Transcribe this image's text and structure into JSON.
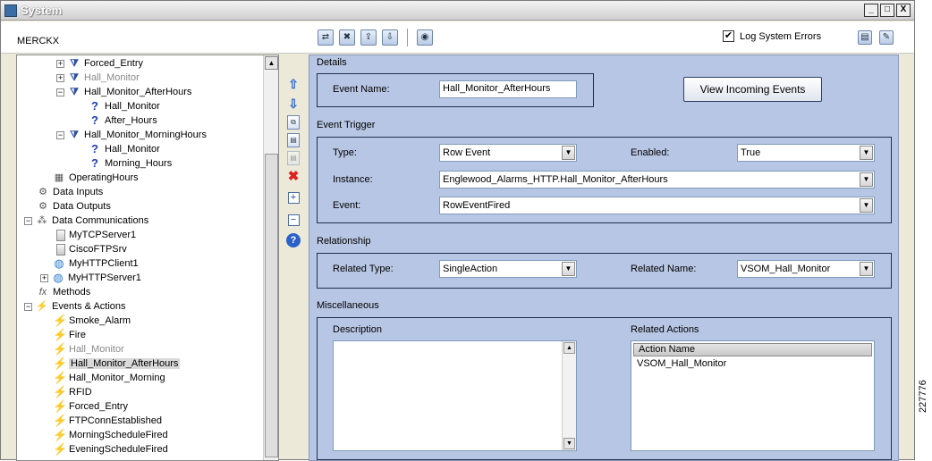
{
  "window": {
    "title": "System",
    "minimize": "_",
    "restore": "□",
    "close": "X"
  },
  "toolbar": {
    "server": "MERCKX",
    "log_errors_label": "Log System Errors",
    "log_errors_checked": "✔"
  },
  "tree": {
    "nodes": [
      {
        "label": "Forced_Entry"
      },
      {
        "label": "Hall_Monitor"
      },
      {
        "label": "Hall_Monitor_AfterHours"
      },
      {
        "label": "Hall_Monitor"
      },
      {
        "label": "After_Hours"
      },
      {
        "label": "Hall_Monitor_MorningHours"
      },
      {
        "label": "Hall_Monitor"
      },
      {
        "label": "Morning_Hours"
      },
      {
        "label": "OperatingHours"
      },
      {
        "label": "Data Inputs"
      },
      {
        "label": "Data Outputs"
      },
      {
        "label": "Data Communications"
      },
      {
        "label": "MyTCPServer1"
      },
      {
        "label": "CiscoFTPSrv"
      },
      {
        "label": "MyHTTPClient1"
      },
      {
        "label": "MyHTTPServer1"
      },
      {
        "label": "Methods"
      },
      {
        "label": "Events & Actions"
      },
      {
        "label": "Smoke_Alarm"
      },
      {
        "label": "Fire"
      },
      {
        "label": "Hall_Monitor"
      },
      {
        "label": "Hall_Monitor_AfterHours"
      },
      {
        "label": "Hall_Monitor_Morning"
      },
      {
        "label": "RFID"
      },
      {
        "label": "Forced_Entry"
      },
      {
        "label": "FTPConnEstablished"
      },
      {
        "label": "MorningScheduleFired"
      },
      {
        "label": "EveningScheduleFired"
      }
    ]
  },
  "details": {
    "section_title": "Details",
    "event_name_label": "Event Name:",
    "event_name_value": "Hall_Monitor_AfterHours",
    "view_events_button": "View Incoming Events"
  },
  "trigger": {
    "section_title": "Event Trigger",
    "type_label": "Type:",
    "type_value": "Row Event",
    "enabled_label": "Enabled:",
    "enabled_value": "True",
    "instance_label": "Instance:",
    "instance_value": "Englewood_Alarms_HTTP.Hall_Monitor_AfterHours",
    "event_label": "Event:",
    "event_value": "RowEventFired"
  },
  "relationship": {
    "section_title": "Relationship",
    "related_type_label": "Related Type:",
    "related_type_value": "SingleAction",
    "related_name_label": "Related Name:",
    "related_name_value": "VSOM_Hall_Monitor"
  },
  "misc": {
    "section_title": "Miscellaneous",
    "description_label": "Description",
    "related_actions_label": "Related Actions",
    "actions_column": "Action Name",
    "actions": [
      "VSOM_Hall_Monitor"
    ]
  },
  "figure_number": "227776"
}
